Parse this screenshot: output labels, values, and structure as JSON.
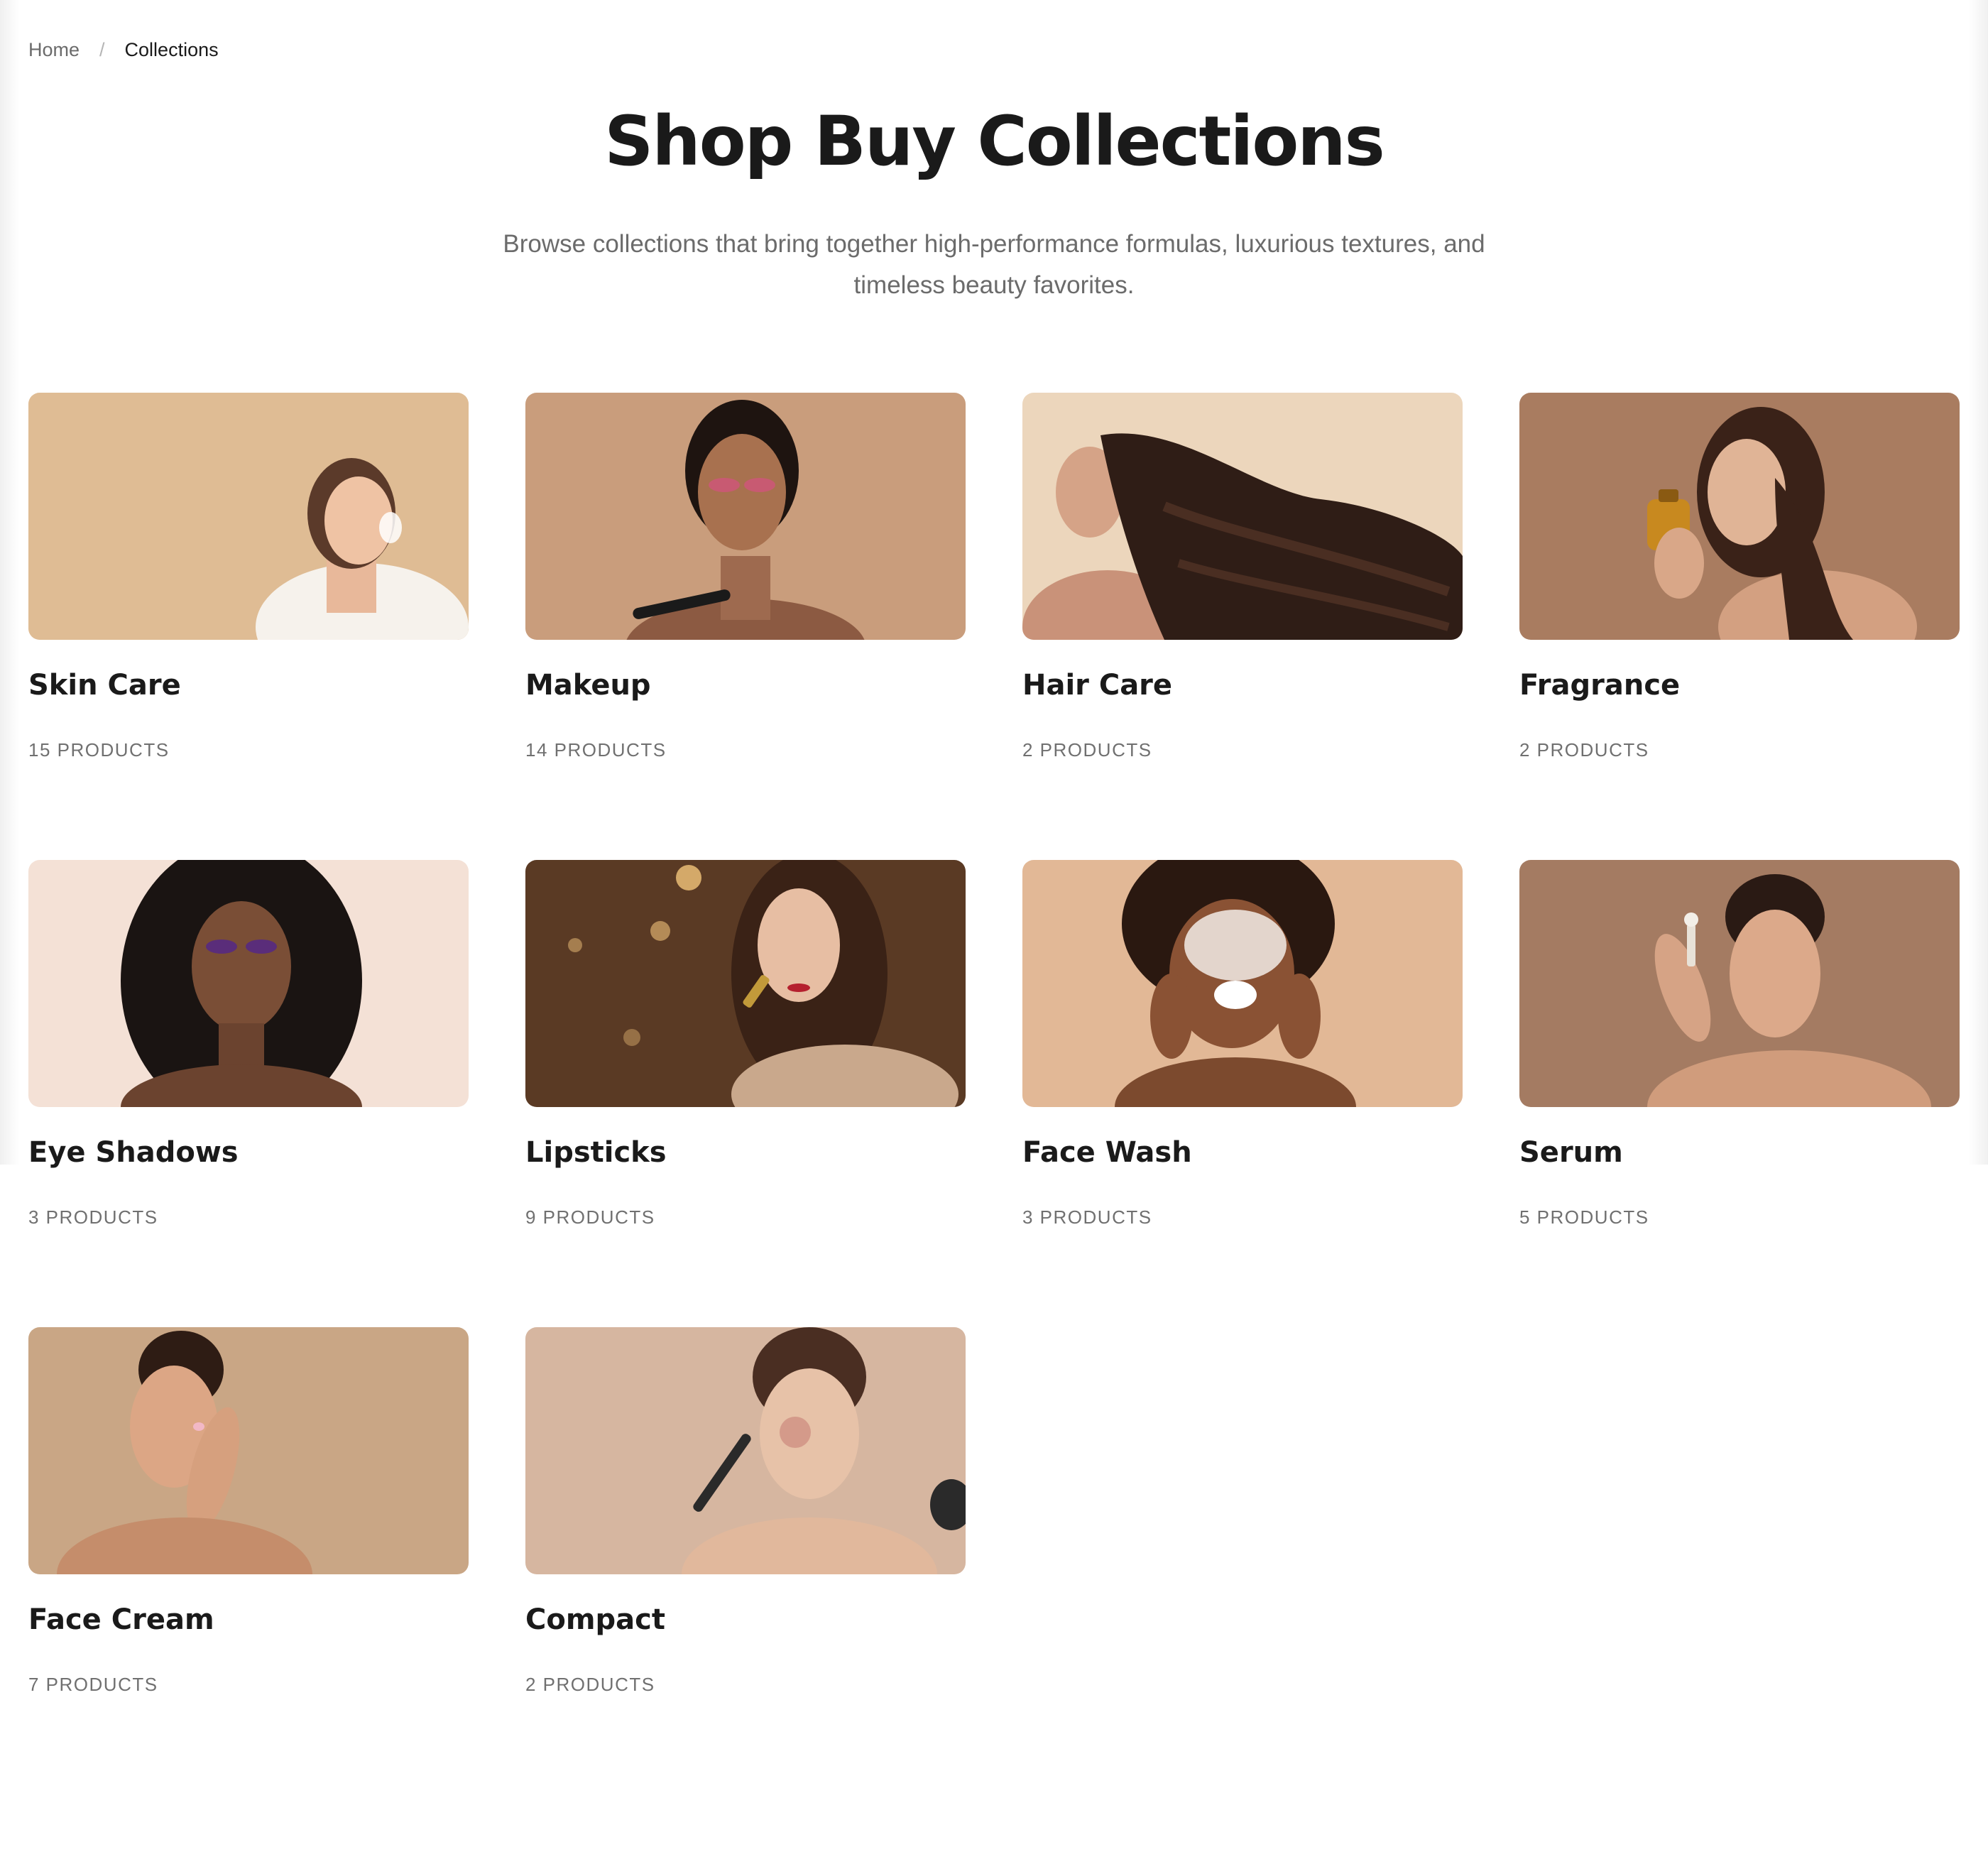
{
  "breadcrumb": {
    "home": "Home",
    "separator": "/",
    "current": "Collections"
  },
  "header": {
    "title": "Shop Buy Collections",
    "description": "Browse collections that bring together high-performance formulas, luxurious textures, and timeless beauty favorites."
  },
  "collections": [
    {
      "title": "Skin Care",
      "count": "15 PRODUCTS",
      "image": "woman-applying-skin-cream-image",
      "bg": "#e3c39a"
    },
    {
      "title": "Makeup",
      "count": "14 PRODUCTS",
      "image": "woman-with-makeup-brush-image",
      "bg": "#c99d7c"
    },
    {
      "title": "Hair Care",
      "count": "2 PRODUCTS",
      "image": "woman-with-long-curly-hair-image",
      "bg": "#ecd6bc"
    },
    {
      "title": "Fragrance",
      "count": "2 PRODUCTS",
      "image": "woman-holding-perfume-image",
      "bg": "#a97c60"
    },
    {
      "title": "Eye Shadows",
      "count": "3 PRODUCTS",
      "image": "woman-with-purple-eyeshadow-image",
      "bg": "#f4e1d6"
    },
    {
      "title": "Lipsticks",
      "count": "9 PRODUCTS",
      "image": "woman-applying-lipstick-image",
      "bg": "#5a3a24"
    },
    {
      "title": "Face Wash",
      "count": "3 PRODUCTS",
      "image": "woman-with-face-foam-image",
      "bg": "#e2b896"
    },
    {
      "title": "Serum",
      "count": "5 PRODUCTS",
      "image": "woman-applying-serum-image",
      "bg": "#a47b62"
    },
    {
      "title": "Face Cream",
      "count": "7 PRODUCTS",
      "image": "woman-touching-face-image",
      "bg": "#c9a685"
    },
    {
      "title": "Compact",
      "count": "2 PRODUCTS",
      "image": "woman-with-blush-brush-image",
      "bg": "#d6b6a0"
    }
  ]
}
